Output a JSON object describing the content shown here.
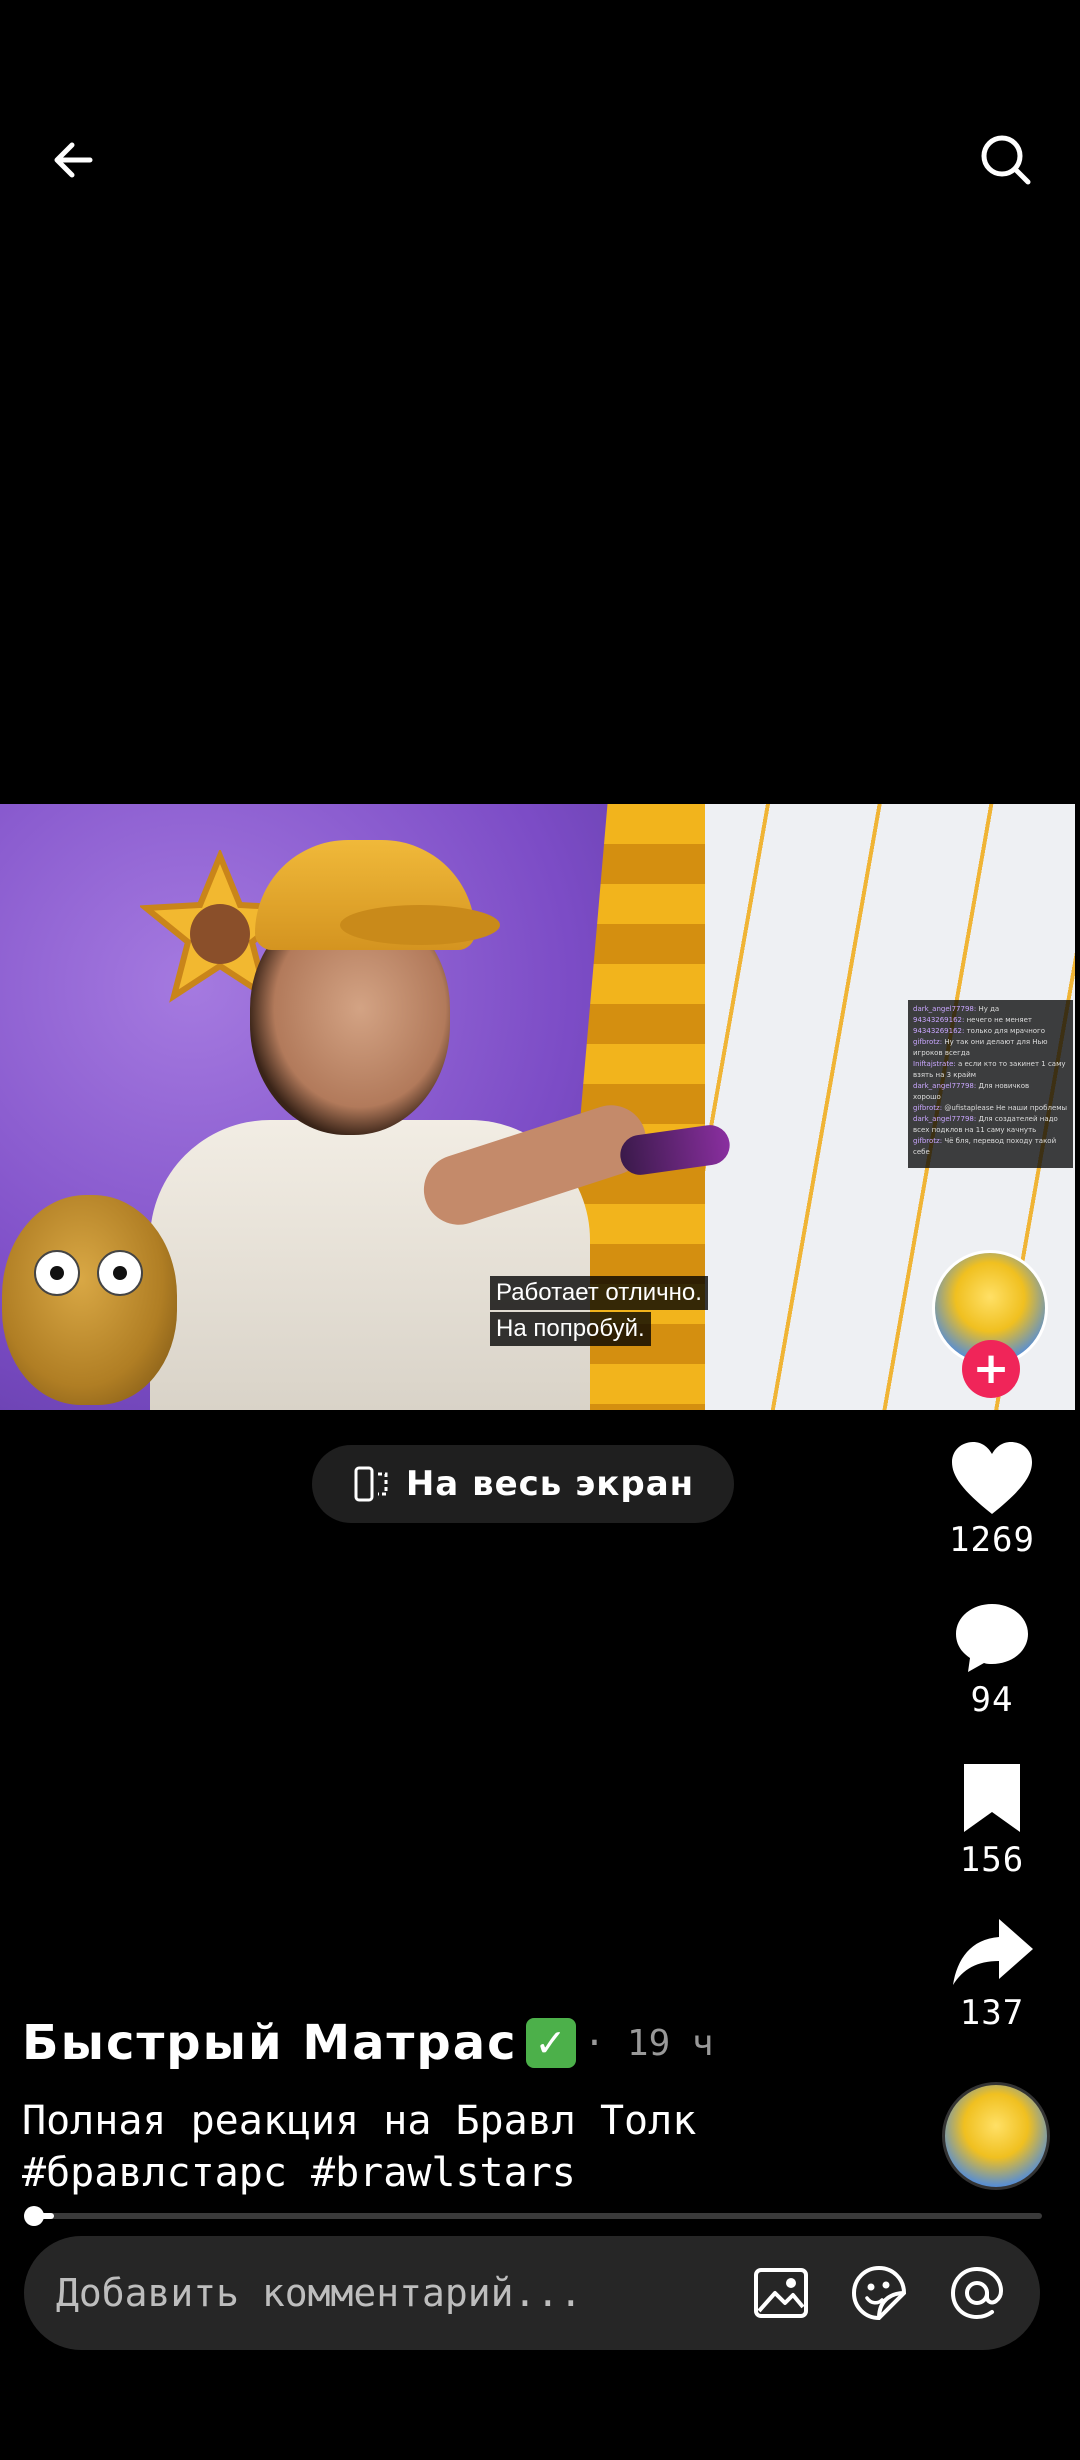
{
  "header": {
    "back_icon": "arrow-left-icon",
    "search_icon": "search-icon"
  },
  "video": {
    "subtitles": [
      "Работает отлично.",
      "На попробуй."
    ],
    "chat": [
      {
        "user": "dark_angel77798:",
        "text": "Ну да"
      },
      {
        "user": "94343269162:",
        "text": "нечего не меняет"
      },
      {
        "user": "94343269162:",
        "text": "только для мрачного"
      },
      {
        "user": "gifbrotz:",
        "text": "Ну так они делают для Нью"
      },
      {
        "user": "",
        "text": "игроков всегда"
      },
      {
        "user": "Iniftajstrate:",
        "text": "а если кто то закинет 1 саму"
      },
      {
        "user": "",
        "text": "взять на 3 крайм"
      },
      {
        "user": "dark_angel77798:",
        "text": "Для новичков"
      },
      {
        "user": "",
        "text": "хорошо"
      },
      {
        "user": "gifbrotz:",
        "text": "@ufistaplease Не наши проблемы"
      },
      {
        "user": "dark_angel77798:",
        "text": "Для создателей надо"
      },
      {
        "user": "",
        "text": "всех подклов на 11 саму качнуть"
      },
      {
        "user": "gifbrotz:",
        "text": "Чё бля, перевод походу такой"
      },
      {
        "user": "",
        "text": "себе"
      }
    ]
  },
  "fullscreen": {
    "label": "На весь экран",
    "icon": "rotate-screen-icon"
  },
  "actions": {
    "like": {
      "count": "1269",
      "icon": "heart-icon"
    },
    "comment": {
      "count": "94",
      "icon": "comment-bubble-icon"
    },
    "bookmark": {
      "count": "156",
      "icon": "bookmark-icon"
    },
    "share": {
      "count": "137",
      "icon": "share-arrow-icon"
    }
  },
  "post": {
    "author": "Быстрый Матрас",
    "verified_badge": "✓",
    "time": "· 19 ч",
    "caption_line1": "Полная реакция на Бравл Толк",
    "caption_line2": "#бравлстарс #brawlstars"
  },
  "follow": {
    "plus": "+"
  },
  "progress": {
    "fraction": 0.02
  },
  "comment_bar": {
    "placeholder": "Добавить комментарий...",
    "image_icon": "image-icon",
    "sticker_icon": "sticker-icon",
    "mention_icon": "at-sign-icon"
  },
  "colors": {
    "background": "#000000",
    "accent": "#f02559",
    "verified": "#4cb04a"
  }
}
